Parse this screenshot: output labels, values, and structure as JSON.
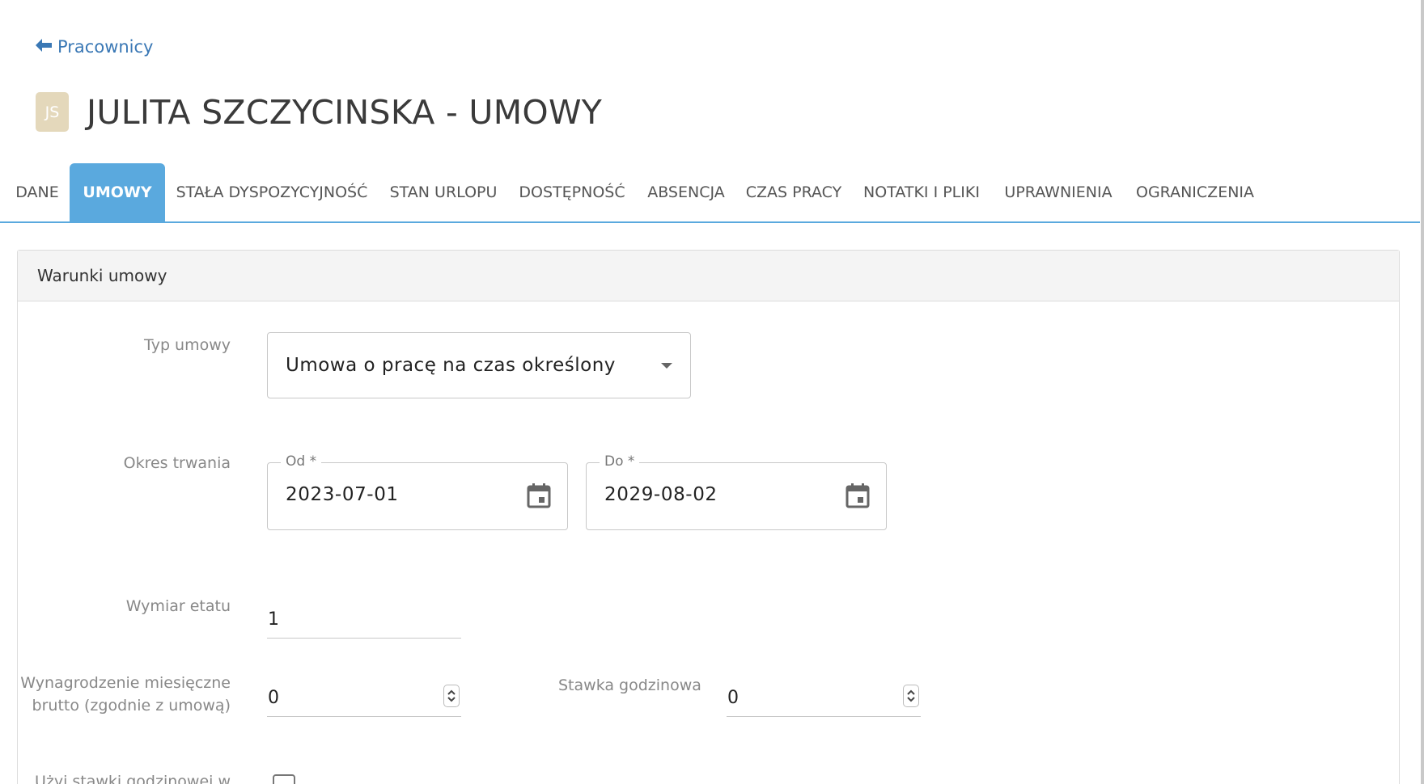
{
  "nav": {
    "back_label": "Pracownicy"
  },
  "header": {
    "avatar_initials": "JS",
    "title": "JULITA SZCZYCINSKA - UMOWY"
  },
  "tabs": [
    {
      "label": "DANE",
      "active": false
    },
    {
      "label": "UMOWY",
      "active": true
    },
    {
      "label": "STAŁA DYSPOZYCYJNOŚĆ",
      "active": false
    },
    {
      "label": "STAN URLOPU",
      "active": false
    },
    {
      "label": "DOSTĘPNOŚĆ",
      "active": false
    },
    {
      "label": "ABSENCJA",
      "active": false
    },
    {
      "label": "CZAS PRACY",
      "active": false
    },
    {
      "label": "NOTATKI I PLIKI",
      "active": false
    },
    {
      "label": "UPRAWNIENIA",
      "active": false
    },
    {
      "label": "OGRANICZENIA",
      "active": false
    }
  ],
  "card": {
    "title": "Warunki umowy"
  },
  "form": {
    "contract_type": {
      "label": "Typ umowy",
      "value": "Umowa o pracę na czas określony"
    },
    "period": {
      "label": "Okres trwania",
      "from_legend": "Od *",
      "from_value": "2023-07-01",
      "to_legend": "Do *",
      "to_value": "2029-08-02"
    },
    "fte": {
      "label": "Wymiar etatu",
      "value": "1"
    },
    "monthly_salary": {
      "label_line1": "Wynagrodzenie miesięczne",
      "label_line2": "brutto (zgodnie z umową)",
      "value": "0"
    },
    "hourly_rate": {
      "label": "Stawka godzinowa",
      "value": "0"
    },
    "use_hourly_rate": {
      "label": "Użyj stawki godzinowej w",
      "checked": false
    }
  },
  "colors": {
    "accent": "#5aa9de",
    "link": "#3a78b5",
    "avatar_bg": "#e4d8bb"
  }
}
